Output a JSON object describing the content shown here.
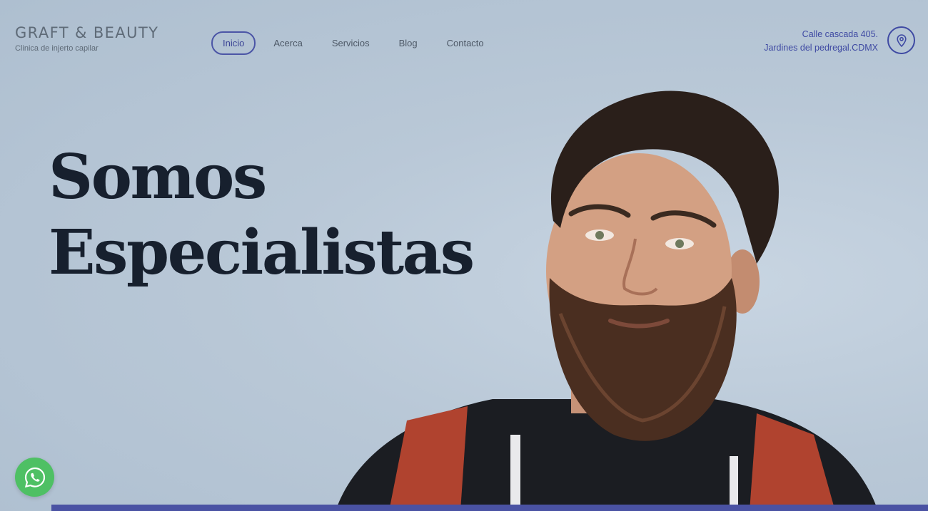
{
  "brand": {
    "name": "GRAFT & BEAUTY",
    "tagline": "Clinica de injerto capilar"
  },
  "nav": {
    "items": [
      {
        "label": "Inicio",
        "active": true
      },
      {
        "label": "Acerca",
        "active": false
      },
      {
        "label": "Servicios",
        "active": false
      },
      {
        "label": "Blog",
        "active": false
      },
      {
        "label": "Contacto",
        "active": false
      }
    ]
  },
  "address": {
    "line1": "Calle cascada 405.",
    "line2": "Jardines del pedregal.CDMX",
    "icon": "location-pin-icon"
  },
  "hero": {
    "line1": "Somos",
    "line2": "Especialistas"
  },
  "colors": {
    "accent": "#3f4aa3",
    "headline": "#17202e",
    "whatsapp": "#4ec064",
    "background": "#bac9d8"
  }
}
